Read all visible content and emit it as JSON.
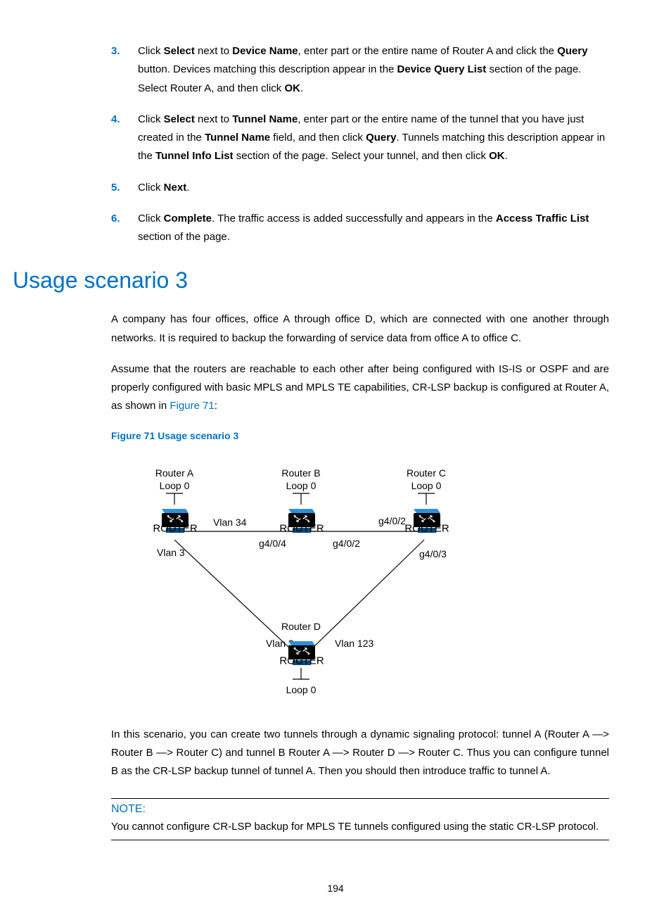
{
  "steps": [
    {
      "n": "3.",
      "parts": [
        {
          "t": "Click ",
          "b": false
        },
        {
          "t": "Select",
          "b": true
        },
        {
          "t": " next to ",
          "b": false
        },
        {
          "t": "Device Name",
          "b": true
        },
        {
          "t": ", enter part or the entire name of Router A and click the ",
          "b": false
        },
        {
          "t": "Query",
          "b": true
        },
        {
          "t": " button. Devices matching this description appear in the ",
          "b": false
        },
        {
          "t": "Device Query List",
          "b": true
        },
        {
          "t": " section of the page. Select Router A, and then click ",
          "b": false
        },
        {
          "t": "OK",
          "b": true
        },
        {
          "t": ".",
          "b": false
        }
      ]
    },
    {
      "n": "4.",
      "parts": [
        {
          "t": "Click ",
          "b": false
        },
        {
          "t": "Select",
          "b": true
        },
        {
          "t": " next to ",
          "b": false
        },
        {
          "t": "Tunnel Name",
          "b": true
        },
        {
          "t": ", enter part or the entire name of the tunnel that you have just created in the ",
          "b": false
        },
        {
          "t": "Tunnel Name",
          "b": true
        },
        {
          "t": " field, and then click ",
          "b": false
        },
        {
          "t": "Query",
          "b": true
        },
        {
          "t": ". Tunnels matching this description appear in the ",
          "b": false
        },
        {
          "t": "Tunnel Info List",
          "b": true
        },
        {
          "t": " section of the page. Select your tunnel, and then click ",
          "b": false
        },
        {
          "t": "OK",
          "b": true
        },
        {
          "t": ".",
          "b": false
        }
      ]
    },
    {
      "n": "5.",
      "parts": [
        {
          "t": "Click ",
          "b": false
        },
        {
          "t": "Next",
          "b": true
        },
        {
          "t": ".",
          "b": false
        }
      ]
    },
    {
      "n": "6.",
      "parts": [
        {
          "t": "Click ",
          "b": false
        },
        {
          "t": "Complete",
          "b": true
        },
        {
          "t": ". The traffic access is added successfully and appears in the ",
          "b": false
        },
        {
          "t": "Access Traffic List",
          "b": true
        },
        {
          "t": " section of the page.",
          "b": false
        }
      ]
    }
  ],
  "heading": "Usage scenario 3",
  "para1": "A company has four offices, office A through office D, which are connected with one another through networks. It is required to backup the forwarding of service data from office A to office C.",
  "para2_pre": "Assume that the routers are reachable to each other after being configured with IS-IS or OSPF and are properly configured with basic MPLS and MPLS TE capabilities, CR-LSP backup is configured at Router A, as shown in ",
  "para2_link": "Figure 71",
  "para2_post": ":",
  "figcap": "Figure 71 Usage scenario 3",
  "diagram": {
    "routerA": "Router A",
    "loopA": "Loop 0",
    "vlan34": "Vlan 34",
    "vlan3a": "Vlan 3",
    "routerB": "Router B",
    "loopB": "Loop 0",
    "g404": "g4/0/4",
    "g402a": "g4/0/2",
    "g402b": "g4/0/2",
    "routerC": "Router C",
    "loopC": "Loop 0",
    "g403": "g4/0/3",
    "routerD": "Router D",
    "loopD": "Loop 0",
    "vlan3d": "Vlan 3",
    "vlan123": "Vlan 123",
    "routerLabel": "ROUTER"
  },
  "para3": "In this scenario, you can create two tunnels through a dynamic signaling protocol: tunnel A (Router A —> Router B —> Router C) and tunnel B Router A —> Router D —> Router C. Thus you can configure tunnel B as the CR-LSP backup tunnel of tunnel A. Then you should then introduce traffic to tunnel A.",
  "note_label": "NOTE:",
  "note_body": "You cannot configure CR-LSP backup for MPLS TE tunnels configured using the static CR-LSP protocol.",
  "pagenum": "194"
}
